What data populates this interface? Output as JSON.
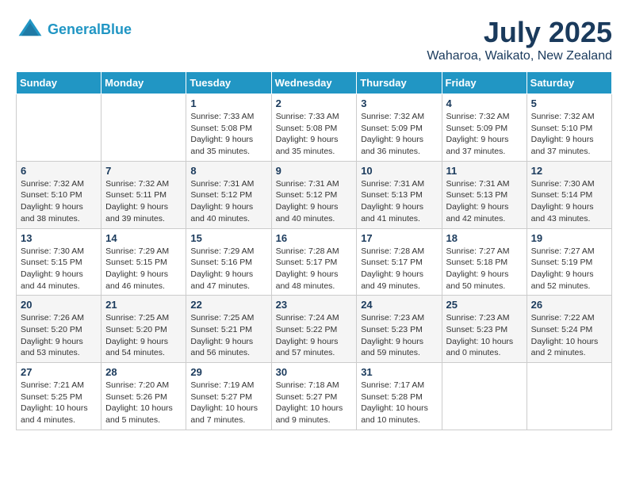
{
  "logo": {
    "line1": "General",
    "line2": "Blue"
  },
  "title": "July 2025",
  "subtitle": "Waharoa, Waikato, New Zealand",
  "days_of_week": [
    "Sunday",
    "Monday",
    "Tuesday",
    "Wednesday",
    "Thursday",
    "Friday",
    "Saturday"
  ],
  "weeks": [
    [
      {
        "day": "",
        "info": ""
      },
      {
        "day": "",
        "info": ""
      },
      {
        "day": "1",
        "info": "Sunrise: 7:33 AM\nSunset: 5:08 PM\nDaylight: 9 hours\nand 35 minutes."
      },
      {
        "day": "2",
        "info": "Sunrise: 7:33 AM\nSunset: 5:08 PM\nDaylight: 9 hours\nand 35 minutes."
      },
      {
        "day": "3",
        "info": "Sunrise: 7:32 AM\nSunset: 5:09 PM\nDaylight: 9 hours\nand 36 minutes."
      },
      {
        "day": "4",
        "info": "Sunrise: 7:32 AM\nSunset: 5:09 PM\nDaylight: 9 hours\nand 37 minutes."
      },
      {
        "day": "5",
        "info": "Sunrise: 7:32 AM\nSunset: 5:10 PM\nDaylight: 9 hours\nand 37 minutes."
      }
    ],
    [
      {
        "day": "6",
        "info": "Sunrise: 7:32 AM\nSunset: 5:10 PM\nDaylight: 9 hours\nand 38 minutes."
      },
      {
        "day": "7",
        "info": "Sunrise: 7:32 AM\nSunset: 5:11 PM\nDaylight: 9 hours\nand 39 minutes."
      },
      {
        "day": "8",
        "info": "Sunrise: 7:31 AM\nSunset: 5:12 PM\nDaylight: 9 hours\nand 40 minutes."
      },
      {
        "day": "9",
        "info": "Sunrise: 7:31 AM\nSunset: 5:12 PM\nDaylight: 9 hours\nand 40 minutes."
      },
      {
        "day": "10",
        "info": "Sunrise: 7:31 AM\nSunset: 5:13 PM\nDaylight: 9 hours\nand 41 minutes."
      },
      {
        "day": "11",
        "info": "Sunrise: 7:31 AM\nSunset: 5:13 PM\nDaylight: 9 hours\nand 42 minutes."
      },
      {
        "day": "12",
        "info": "Sunrise: 7:30 AM\nSunset: 5:14 PM\nDaylight: 9 hours\nand 43 minutes."
      }
    ],
    [
      {
        "day": "13",
        "info": "Sunrise: 7:30 AM\nSunset: 5:15 PM\nDaylight: 9 hours\nand 44 minutes."
      },
      {
        "day": "14",
        "info": "Sunrise: 7:29 AM\nSunset: 5:15 PM\nDaylight: 9 hours\nand 46 minutes."
      },
      {
        "day": "15",
        "info": "Sunrise: 7:29 AM\nSunset: 5:16 PM\nDaylight: 9 hours\nand 47 minutes."
      },
      {
        "day": "16",
        "info": "Sunrise: 7:28 AM\nSunset: 5:17 PM\nDaylight: 9 hours\nand 48 minutes."
      },
      {
        "day": "17",
        "info": "Sunrise: 7:28 AM\nSunset: 5:17 PM\nDaylight: 9 hours\nand 49 minutes."
      },
      {
        "day": "18",
        "info": "Sunrise: 7:27 AM\nSunset: 5:18 PM\nDaylight: 9 hours\nand 50 minutes."
      },
      {
        "day": "19",
        "info": "Sunrise: 7:27 AM\nSunset: 5:19 PM\nDaylight: 9 hours\nand 52 minutes."
      }
    ],
    [
      {
        "day": "20",
        "info": "Sunrise: 7:26 AM\nSunset: 5:20 PM\nDaylight: 9 hours\nand 53 minutes."
      },
      {
        "day": "21",
        "info": "Sunrise: 7:25 AM\nSunset: 5:20 PM\nDaylight: 9 hours\nand 54 minutes."
      },
      {
        "day": "22",
        "info": "Sunrise: 7:25 AM\nSunset: 5:21 PM\nDaylight: 9 hours\nand 56 minutes."
      },
      {
        "day": "23",
        "info": "Sunrise: 7:24 AM\nSunset: 5:22 PM\nDaylight: 9 hours\nand 57 minutes."
      },
      {
        "day": "24",
        "info": "Sunrise: 7:23 AM\nSunset: 5:23 PM\nDaylight: 9 hours\nand 59 minutes."
      },
      {
        "day": "25",
        "info": "Sunrise: 7:23 AM\nSunset: 5:23 PM\nDaylight: 10 hours\nand 0 minutes."
      },
      {
        "day": "26",
        "info": "Sunrise: 7:22 AM\nSunset: 5:24 PM\nDaylight: 10 hours\nand 2 minutes."
      }
    ],
    [
      {
        "day": "27",
        "info": "Sunrise: 7:21 AM\nSunset: 5:25 PM\nDaylight: 10 hours\nand 4 minutes."
      },
      {
        "day": "28",
        "info": "Sunrise: 7:20 AM\nSunset: 5:26 PM\nDaylight: 10 hours\nand 5 minutes."
      },
      {
        "day": "29",
        "info": "Sunrise: 7:19 AM\nSunset: 5:27 PM\nDaylight: 10 hours\nand 7 minutes."
      },
      {
        "day": "30",
        "info": "Sunrise: 7:18 AM\nSunset: 5:27 PM\nDaylight: 10 hours\nand 9 minutes."
      },
      {
        "day": "31",
        "info": "Sunrise: 7:17 AM\nSunset: 5:28 PM\nDaylight: 10 hours\nand 10 minutes."
      },
      {
        "day": "",
        "info": ""
      },
      {
        "day": "",
        "info": ""
      }
    ]
  ]
}
